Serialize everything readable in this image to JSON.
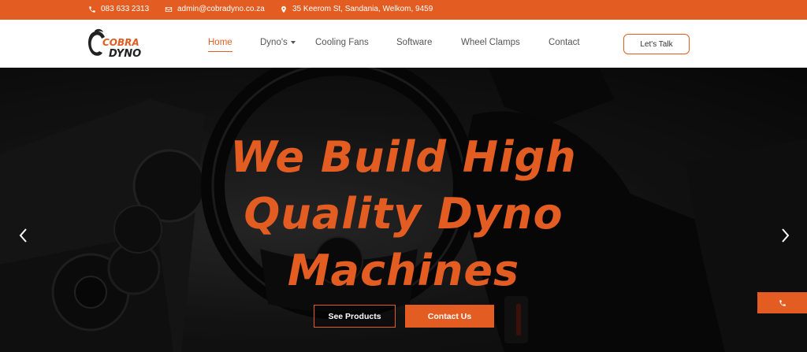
{
  "topbar": {
    "phone": "083 633 2313",
    "email": "admin@cobradyno.co.za",
    "address": "35 Keerom St, Sandania, Welkom, 9459"
  },
  "logo": {
    "line1": "COBRA",
    "line2": "DYNO"
  },
  "nav": {
    "items": [
      {
        "label": "Home"
      },
      {
        "label": "Dyno's"
      },
      {
        "label": "Cooling Fans"
      },
      {
        "label": "Software"
      },
      {
        "label": "Wheel Clamps"
      },
      {
        "label": "Contact"
      }
    ],
    "cta": "Let's Talk"
  },
  "hero": {
    "title_lines": [
      "We Build High",
      "Quality Dyno",
      "Machines"
    ],
    "primary_button": "See Products",
    "secondary_button": "Contact Us"
  },
  "colors": {
    "accent": "#e35d22",
    "header_bg": "#ffffff",
    "hero_bg": "#1a1a1a"
  },
  "icons": {
    "topbar": [
      "phone-icon",
      "mail-icon",
      "location-icon"
    ],
    "carousel": [
      "chevron-left-icon",
      "chevron-right-icon"
    ],
    "floating": "phone-icon"
  }
}
